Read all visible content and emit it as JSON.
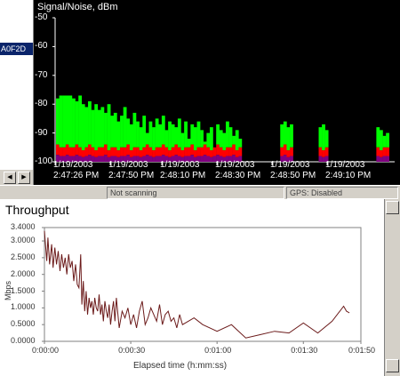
{
  "left_panel": {
    "selected_label": "A0F2D",
    "scroll_left_icon": "arrow-left-icon",
    "scroll_right_icon": "arrow-right-icon"
  },
  "status": {
    "scan": "Not scanning",
    "gps": "GPS: Disabled"
  },
  "colors": {
    "signal": "#00ff00",
    "noise": "#ff0000",
    "noise_dark": "#800080",
    "throughput_line": "#6b1a1a"
  },
  "chart_data": [
    {
      "type": "bar",
      "title": "Signal/Noise, dBm",
      "ylim": [
        -100,
        -50
      ],
      "yticks": [
        "-50",
        "-60",
        "-70",
        "-80",
        "-90",
        "-100"
      ],
      "xtick_labels": [
        [
          "1/19/2003",
          "2:47:26 PM"
        ],
        [
          "1/19/2003",
          "2:47:50 PM"
        ],
        [
          "1/19/2003",
          "2:48:10 PM"
        ],
        [
          "1/19/2003",
          "2:48:30 PM"
        ],
        [
          "1/19/2003",
          "2:48:50 PM"
        ],
        [
          "1/19/2003",
          "2:49:10 PM"
        ]
      ],
      "series": [
        {
          "name": "signal",
          "values": [
            -78,
            -77,
            -77,
            -77,
            -77,
            -78,
            -79,
            -77,
            -80,
            -81,
            -79,
            -82,
            -80,
            -82,
            -81,
            -83,
            -80,
            -84,
            -83,
            -86,
            -84,
            -81,
            -85,
            -87,
            -83,
            -86,
            -88,
            -84,
            -90,
            -86,
            -88,
            -85,
            -87,
            -84,
            -89,
            -86,
            -87,
            -88,
            -85,
            -90,
            -86,
            -92,
            -87,
            -88,
            -86,
            -89,
            -93,
            -90,
            -88,
            -95,
            -87,
            -89,
            -90,
            -86,
            -88,
            -91,
            -89,
            -92,
            -100,
            -100,
            -100,
            -100,
            -100,
            -100,
            -100,
            -100,
            -100,
            -100,
            -100,
            -100,
            -87,
            -86,
            -88,
            -87,
            -100,
            -100,
            -100,
            -100,
            -100,
            -100,
            -100,
            -100,
            -88,
            -87,
            -89,
            -100,
            -100,
            -100,
            -100,
            -100,
            -100,
            -100,
            -100,
            -100,
            -100,
            -100,
            -100,
            -100,
            -100,
            -100,
            -88,
            -89,
            -91,
            -90,
            -100,
            -100
          ]
        },
        {
          "name": "noise",
          "values": [
            -94,
            -95,
            -95,
            -94,
            -95,
            -95,
            -94,
            -95,
            -96,
            -95,
            -94,
            -95,
            -96,
            -95,
            -95,
            -94,
            -96,
            -95,
            -95,
            -96,
            -95,
            -95,
            -94,
            -96,
            -95,
            -95,
            -96,
            -95,
            -94,
            -95,
            -96,
            -95,
            -95,
            -94,
            -95,
            -96,
            -95,
            -94,
            -95,
            -96,
            -95,
            -95,
            -94,
            -96,
            -95,
            -95,
            -94,
            -95,
            -96,
            -95,
            -94,
            -95,
            -96,
            -95,
            -95,
            -94,
            -96,
            -95,
            -100,
            -100,
            -100,
            -100,
            -100,
            -100,
            -100,
            -100,
            -100,
            -100,
            -100,
            -100,
            -95,
            -94,
            -96,
            -95,
            -100,
            -100,
            -100,
            -100,
            -100,
            -100,
            -100,
            -100,
            -95,
            -96,
            -95,
            -100,
            -100,
            -100,
            -100,
            -100,
            -100,
            -100,
            -100,
            -100,
            -100,
            -100,
            -100,
            -100,
            -100,
            -100,
            -95,
            -96,
            -95,
            -95,
            -100,
            -100
          ]
        }
      ]
    },
    {
      "type": "line",
      "title": "Throughput",
      "xlabel": "Elapsed time (h:mm:ss)",
      "ylabel": "Mbps",
      "xlim": [
        0,
        110
      ],
      "ylim": [
        0,
        3.4
      ],
      "xticks": [
        0,
        30,
        60,
        90,
        110
      ],
      "xtick_labels": [
        "0:00:00",
        "0:00:30",
        "0:01:00",
        "0:01:30",
        "0:01:50"
      ],
      "yticks": [
        0,
        0.5,
        1.0,
        1.5,
        2.0,
        2.5,
        3.0,
        3.4
      ],
      "ytick_labels": [
        "0.0000",
        "0.5000",
        "1.0000",
        "1.5000",
        "2.0000",
        "2.5000",
        "3.0000",
        "3.4000"
      ],
      "series": [
        {
          "x": [
            0,
            0.8,
            1.2,
            1.8,
            2.5,
            3,
            3.6,
            4.2,
            4.8,
            5.4,
            6,
            6.6,
            7.2,
            7.8,
            8.4,
            9,
            9.6,
            10.2,
            10.8,
            11.4,
            12,
            12.6,
            13,
            13.5,
            14,
            14.5,
            15,
            15.5,
            16,
            16.5,
            17,
            17.5,
            18,
            18.5,
            19,
            19.5,
            20,
            20.5,
            21,
            21.5,
            22,
            22.5,
            23,
            23.5,
            24,
            24.5,
            25,
            26,
            27,
            28,
            29,
            30,
            31,
            32,
            33,
            34,
            35,
            36,
            37,
            38,
            39,
            40,
            41,
            42,
            43,
            44,
            45,
            46,
            47,
            48,
            50,
            52,
            55,
            60,
            65,
            70,
            75,
            80,
            85,
            90,
            95,
            100,
            104,
            105,
            106
          ],
          "y": [
            3.3,
            2.4,
            3.1,
            2.3,
            2.9,
            2.2,
            2.8,
            2.3,
            2.7,
            2.1,
            2.6,
            2.2,
            2.5,
            2.0,
            2.6,
            2.2,
            2.4,
            1.8,
            2.3,
            1.7,
            1.6,
            2.6,
            1.1,
            1.8,
            0.9,
            1.5,
            0.8,
            1.3,
            1.0,
            1.2,
            0.8,
            1.3,
            1.0,
            0.9,
            1.4,
            0.8,
            1.1,
            0.6,
            1.2,
            0.9,
            0.7,
            1.1,
            0.5,
            0.9,
            1.2,
            0.6,
            1.3,
            0.4,
            0.9,
            0.7,
            1.0,
            0.5,
            0.8,
            0.4,
            0.9,
            1.2,
            0.5,
            0.7,
            1.0,
            0.8,
            0.6,
            1.1,
            0.5,
            0.8,
            0.9,
            0.6,
            0.7,
            0.4,
            0.8,
            0.5,
            0.6,
            0.7,
            0.5,
            0.3,
            0.5,
            0.1,
            0.2,
            0.3,
            0.25,
            0.55,
            0.25,
            0.6,
            1.05,
            0.9,
            0.85
          ]
        }
      ]
    }
  ]
}
